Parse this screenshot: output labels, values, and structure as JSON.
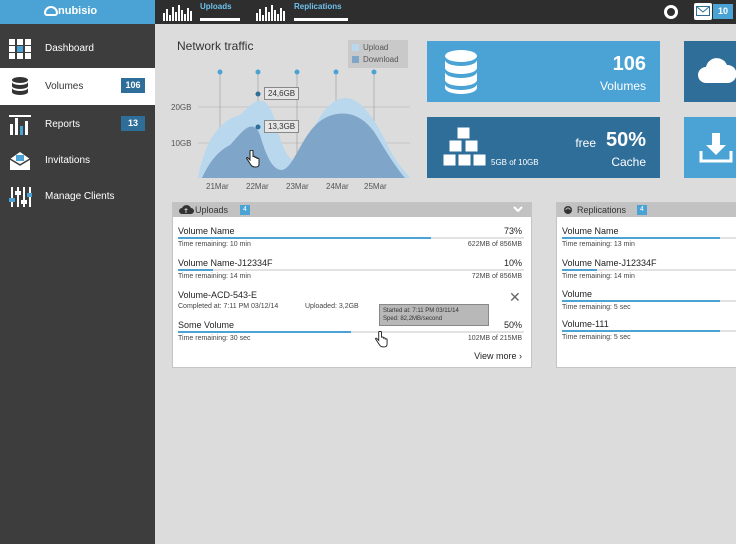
{
  "app": {
    "logo_text": "nubisio"
  },
  "topbar": {
    "tabs": [
      {
        "label": "Uploads"
      },
      {
        "label": "Replications"
      }
    ],
    "mail_count": "10"
  },
  "sidebar": {
    "items": [
      {
        "label": "Dashboard",
        "icon": "grid-icon"
      },
      {
        "label": "Volumes",
        "icon": "database-icon",
        "badge": "106"
      },
      {
        "label": "Reports",
        "icon": "bar-chart-icon",
        "badge": "13"
      },
      {
        "label": "Invitations",
        "icon": "mail-icon"
      },
      {
        "label": "Manage Clients",
        "icon": "sliders-icon"
      }
    ]
  },
  "chart": {
    "title": "Network traffic",
    "legend": [
      {
        "label": "Upload",
        "color": "#b9d8ee"
      },
      {
        "label": "Download",
        "color": "#7fa6c9"
      }
    ],
    "y_ticks": [
      "20GB",
      "10GB"
    ],
    "x_ticks": [
      "21Mar",
      "22Mar",
      "23Mar",
      "24Mar",
      "25Mar"
    ],
    "tooltips": [
      "24,6GB",
      "13,3GB"
    ]
  },
  "chart_data": {
    "type": "area",
    "title": "Network traffic",
    "categories": [
      "21Mar",
      "22Mar",
      "23Mar",
      "24Mar",
      "25Mar"
    ],
    "series": [
      {
        "name": "Upload",
        "values": [
          10,
          24.6,
          8,
          22,
          14
        ]
      },
      {
        "name": "Download",
        "values": [
          4,
          13.3,
          2,
          18,
          10
        ]
      }
    ],
    "y_ticks": [
      "20GB",
      "10GB"
    ],
    "legend": "top-right"
  },
  "tiles": {
    "volumes": {
      "value": "106",
      "label": "Volumes",
      "icon": "database-icon"
    },
    "cache": {
      "prefix": "free",
      "value": "50%",
      "label": "Cache",
      "detail": "5GB of 10GB",
      "icon": "cubes-icon"
    },
    "cloud": {
      "icon": "cloud-icon"
    },
    "download": {
      "icon": "download-icon"
    }
  },
  "uploads": {
    "title": "Uploads",
    "count": "4",
    "rows": [
      {
        "name": "Volume Name",
        "pct": "73%",
        "progress": 0.73,
        "left": "Time remaining: 10 min",
        "right": "622MB of 856MB"
      },
      {
        "name": "Volume Name-J12334F",
        "pct": "10%",
        "progress": 0.1,
        "left": "Time remaining: 14 min",
        "right": "72MB of 856MB"
      },
      {
        "name": "Volume-ACD-543-E",
        "left": "Completed at: 7:11 PM 03/12/14",
        "right": "Uploaded: 3,2GB"
      },
      {
        "name": "Some Volume",
        "pct": "50%",
        "progress": 0.5,
        "left": "Time remaining: 30 sec",
        "right": "102MB of 215MB"
      }
    ],
    "tooltip_line1": "Started at: 7:11 PM 03/11/14",
    "tooltip_line2": "Sped: 82,2MB/second",
    "view_more": "View more ›"
  },
  "replications": {
    "title": "Replications",
    "count": "4",
    "rows": [
      {
        "name": "Volume Name",
        "left": "Time remaining: 13 min",
        "progress": 0.9
      },
      {
        "name": "Volume Name-J12334F",
        "left": "Time remaining: 14 min",
        "progress": 0.2
      },
      {
        "name": "Volume",
        "left": "Time remaining: 5 sec",
        "progress": 0.9
      },
      {
        "name": "Volume-111",
        "left": "Time remaining: 5 sec",
        "progress": 0.9
      }
    ]
  }
}
